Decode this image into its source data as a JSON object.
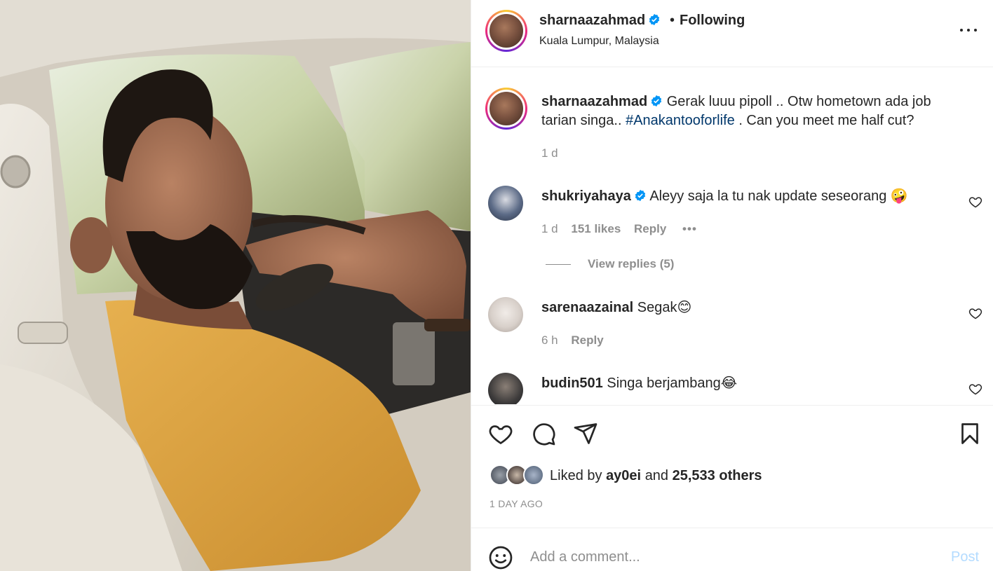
{
  "post": {
    "author": "sharnaazahmad",
    "follow_status": "Following",
    "separator": "•",
    "location": "Kuala Lumpur, Malaysia",
    "verified": true
  },
  "caption": {
    "username": "sharnaazahmad",
    "text_part1": "Gerak luuu pipoll .. Otw hometown ada job",
    "text_part2": "tarian singa..",
    "hashtag": "#Anakantooforlife",
    "text_part3": ". Can you meet me half cut?",
    "time": "1 d"
  },
  "comments": [
    {
      "username": "shukriyahaya",
      "verified": true,
      "text": "Aleyy saja la tu nak update seseorang 🤪",
      "time": "1 d",
      "likes": "151 likes",
      "reply": "Reply",
      "more": "•••",
      "view_replies": "View replies (5)"
    },
    {
      "username": "sarenaazainal",
      "verified": false,
      "text": "Segak😊",
      "time": "6 h",
      "reply": "Reply"
    },
    {
      "username": "budin501",
      "verified": false,
      "text": "Singa berjambang😂"
    }
  ],
  "likes": {
    "prefix": "Liked by",
    "user": "ay0ei",
    "middle": "and",
    "others": "25,533 others"
  },
  "timestamp": "1 DAY AGO",
  "add_comment": {
    "placeholder": "Add a comment...",
    "post_label": "Post"
  },
  "icons": [
    "more-icon",
    "verified-icon",
    "heart-icon",
    "comment-icon",
    "share-icon",
    "bookmark-icon",
    "emoji-icon"
  ],
  "colors": {
    "verified": "#0095f6",
    "hashtag": "#00376b",
    "post_disabled": "#b3dbff",
    "muted": "#8e8e8e"
  }
}
